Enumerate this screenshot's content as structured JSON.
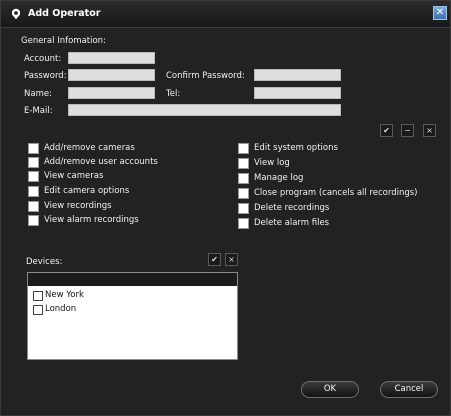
{
  "window": {
    "title": "Add Operator",
    "close_symbol": "✕"
  },
  "general": {
    "section_label": "General Infomation:",
    "account_label": "Account:",
    "account_value": "",
    "password_label": "Password:",
    "password_value": "",
    "confirm_password_label": "Confirm Password:",
    "confirm_password_value": "",
    "name_label": "Name:",
    "name_value": "",
    "tel_label": "Tel:",
    "tel_value": "",
    "email_label": "E-Mail:",
    "email_value": ""
  },
  "bulk_buttons": {
    "check_all": "✔",
    "minus": "−",
    "clear": "×"
  },
  "permissions_left": [
    {
      "label": "Add/remove cameras",
      "checked": false
    },
    {
      "label": "Add/remove user accounts",
      "checked": false
    },
    {
      "label": "View cameras",
      "checked": false
    },
    {
      "label": "Edit camera options",
      "checked": false
    },
    {
      "label": "View recordings",
      "checked": false
    },
    {
      "label": "View alarm recordings",
      "checked": false
    }
  ],
  "permissions_right": [
    {
      "label": "Edit system options",
      "checked": false
    },
    {
      "label": "View log",
      "checked": false
    },
    {
      "label": "Manage log",
      "checked": false
    },
    {
      "label": "Close program (cancels all recordings)",
      "checked": false
    },
    {
      "label": "Delete recordings",
      "checked": false
    },
    {
      "label": "Delete alarm files",
      "checked": false
    }
  ],
  "devices": {
    "label": "Devices:",
    "check_all": "✔",
    "clear": "×",
    "items": [
      {
        "label": "New York",
        "checked": false
      },
      {
        "label": "London",
        "checked": false
      }
    ]
  },
  "footer": {
    "ok_label": "OK",
    "cancel_label": "Cancel"
  },
  "colors": {
    "background": "#222222",
    "field_fill": "#dedede",
    "text": "#f2f2f2"
  }
}
